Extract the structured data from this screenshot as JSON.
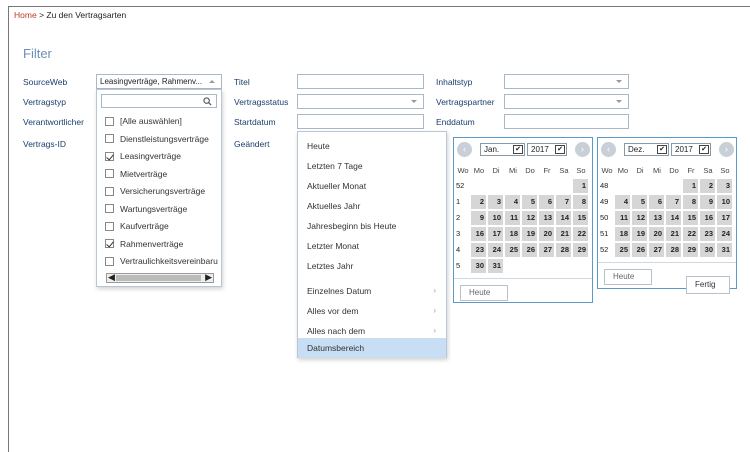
{
  "breadcrumb": {
    "home": "Home",
    "sep": ">",
    "current": "Zu den Vertragsarten"
  },
  "filter_title": "Filter",
  "labels": {
    "sourceweb": "SourceWeb",
    "vertragstyp": "Vertragstyp",
    "verantwortlicher": "Verantwortlicher",
    "vertrags_id": "Vertrags-ID",
    "titel": "Titel",
    "vertragsstatus": "Vertragsstatus",
    "startdatum": "Startdatum",
    "geaendert": "Geändert",
    "inhaltstyp": "Inhaltstyp",
    "vertragspartner": "Vertragspartner",
    "enddatum": "Enddatum"
  },
  "sourceweb_value": "Leasingverträge, Rahmenv...",
  "checklist": [
    {
      "label": "[Alle auswählen]",
      "checked": false
    },
    {
      "label": "Dienstleistungsverträge",
      "checked": false
    },
    {
      "label": "Leasingverträge",
      "checked": true
    },
    {
      "label": "Mietverträge",
      "checked": false
    },
    {
      "label": "Versicherungsverträge",
      "checked": false
    },
    {
      "label": "Wartungsverträge",
      "checked": false
    },
    {
      "label": "Kaufverträge",
      "checked": false
    },
    {
      "label": "Rahmenverträge",
      "checked": true
    },
    {
      "label": "Vertraulichkeitsvereinbaru",
      "checked": false
    }
  ],
  "date_menu": [
    {
      "label": "Heute"
    },
    {
      "label": "Letzten 7 Tage"
    },
    {
      "label": "Aktueller Monat"
    },
    {
      "label": "Aktuelles Jahr"
    },
    {
      "label": "Jahresbeginn bis Heute"
    },
    {
      "label": "Letzter Monat"
    },
    {
      "label": "Letztes Jahr"
    },
    {
      "label": "Einzelnes Datum",
      "sub": "›"
    },
    {
      "label": "Alles vor dem",
      "sub": "›"
    },
    {
      "label": "Alles nach dem",
      "sub": "›"
    },
    {
      "label": "Datumsbereich",
      "selected": true
    }
  ],
  "weekday_headers": [
    "Wo",
    "Mo",
    "Di",
    "Mi",
    "Do",
    "Fr",
    "Sa",
    "So"
  ],
  "calendar_left": {
    "month": "Jan.",
    "year": "2017",
    "weeks": [
      {
        "wk": "52",
        "days": [
          "",
          "",
          "",
          "",
          "",
          "",
          "1"
        ]
      },
      {
        "wk": "1",
        "days": [
          "2",
          "3",
          "4",
          "5",
          "6",
          "7",
          "8"
        ]
      },
      {
        "wk": "2",
        "days": [
          "9",
          "10",
          "11",
          "12",
          "13",
          "14",
          "15"
        ]
      },
      {
        "wk": "3",
        "days": [
          "16",
          "17",
          "18",
          "19",
          "20",
          "21",
          "22"
        ]
      },
      {
        "wk": "4",
        "days": [
          "23",
          "24",
          "25",
          "26",
          "27",
          "28",
          "29"
        ]
      },
      {
        "wk": "5",
        "days": [
          "30",
          "31",
          "",
          "",
          "",
          "",
          ""
        ]
      }
    ],
    "today_label": "Heute"
  },
  "calendar_right": {
    "month": "Dez.",
    "year": "2017",
    "weeks": [
      {
        "wk": "48",
        "days": [
          "",
          "",
          "",
          "",
          "1",
          "2",
          "3"
        ]
      },
      {
        "wk": "49",
        "days": [
          "4",
          "5",
          "6",
          "7",
          "8",
          "9",
          "10"
        ]
      },
      {
        "wk": "50",
        "days": [
          "11",
          "12",
          "13",
          "14",
          "15",
          "16",
          "17"
        ]
      },
      {
        "wk": "51",
        "days": [
          "18",
          "19",
          "20",
          "21",
          "22",
          "23",
          "24"
        ]
      },
      {
        "wk": "52",
        "days": [
          "25",
          "26",
          "27",
          "28",
          "29",
          "30",
          "31"
        ]
      }
    ],
    "today_label": "Heute",
    "done_label": "Fertig"
  },
  "glyphs": {
    "nav_prev": "‹",
    "nav_next": "›",
    "chev": "✔",
    "scroll_left": "◀",
    "scroll_right": "▶",
    "search": "🔍"
  },
  "colors": {
    "home_link": "#c0392b",
    "filter_title": "#6b8fb8",
    "label": "#1a3d6d",
    "calendar_border": "#5a99c8",
    "selected_item": "#c7def4",
    "day_cell": "#d6d6d6"
  }
}
